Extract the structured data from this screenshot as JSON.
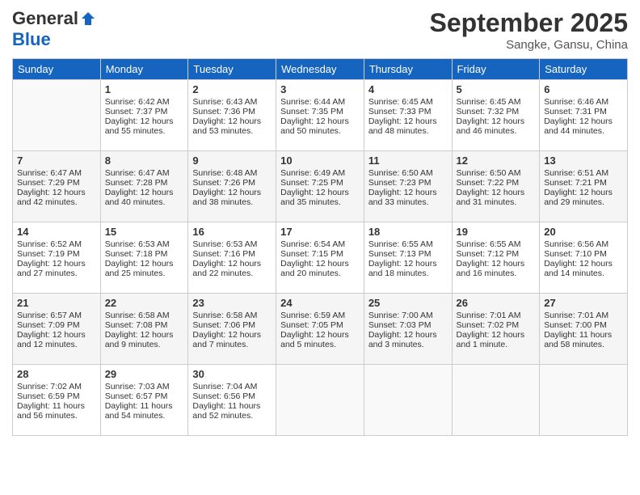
{
  "header": {
    "logo_general": "General",
    "logo_blue": "Blue",
    "month_title": "September 2025",
    "location": "Sangke, Gansu, China"
  },
  "days_of_week": [
    "Sunday",
    "Monday",
    "Tuesday",
    "Wednesday",
    "Thursday",
    "Friday",
    "Saturday"
  ],
  "weeks": [
    [
      {
        "day": "",
        "sunrise": "",
        "sunset": "",
        "daylight": "",
        "empty": true
      },
      {
        "day": "1",
        "sunrise": "Sunrise: 6:42 AM",
        "sunset": "Sunset: 7:37 PM",
        "daylight": "Daylight: 12 hours and 55 minutes."
      },
      {
        "day": "2",
        "sunrise": "Sunrise: 6:43 AM",
        "sunset": "Sunset: 7:36 PM",
        "daylight": "Daylight: 12 hours and 53 minutes."
      },
      {
        "day": "3",
        "sunrise": "Sunrise: 6:44 AM",
        "sunset": "Sunset: 7:35 PM",
        "daylight": "Daylight: 12 hours and 50 minutes."
      },
      {
        "day": "4",
        "sunrise": "Sunrise: 6:45 AM",
        "sunset": "Sunset: 7:33 PM",
        "daylight": "Daylight: 12 hours and 48 minutes."
      },
      {
        "day": "5",
        "sunrise": "Sunrise: 6:45 AM",
        "sunset": "Sunset: 7:32 PM",
        "daylight": "Daylight: 12 hours and 46 minutes."
      },
      {
        "day": "6",
        "sunrise": "Sunrise: 6:46 AM",
        "sunset": "Sunset: 7:31 PM",
        "daylight": "Daylight: 12 hours and 44 minutes."
      }
    ],
    [
      {
        "day": "7",
        "sunrise": "Sunrise: 6:47 AM",
        "sunset": "Sunset: 7:29 PM",
        "daylight": "Daylight: 12 hours and 42 minutes."
      },
      {
        "day": "8",
        "sunrise": "Sunrise: 6:47 AM",
        "sunset": "Sunset: 7:28 PM",
        "daylight": "Daylight: 12 hours and 40 minutes."
      },
      {
        "day": "9",
        "sunrise": "Sunrise: 6:48 AM",
        "sunset": "Sunset: 7:26 PM",
        "daylight": "Daylight: 12 hours and 38 minutes."
      },
      {
        "day": "10",
        "sunrise": "Sunrise: 6:49 AM",
        "sunset": "Sunset: 7:25 PM",
        "daylight": "Daylight: 12 hours and 35 minutes."
      },
      {
        "day": "11",
        "sunrise": "Sunrise: 6:50 AM",
        "sunset": "Sunset: 7:23 PM",
        "daylight": "Daylight: 12 hours and 33 minutes."
      },
      {
        "day": "12",
        "sunrise": "Sunrise: 6:50 AM",
        "sunset": "Sunset: 7:22 PM",
        "daylight": "Daylight: 12 hours and 31 minutes."
      },
      {
        "day": "13",
        "sunrise": "Sunrise: 6:51 AM",
        "sunset": "Sunset: 7:21 PM",
        "daylight": "Daylight: 12 hours and 29 minutes."
      }
    ],
    [
      {
        "day": "14",
        "sunrise": "Sunrise: 6:52 AM",
        "sunset": "Sunset: 7:19 PM",
        "daylight": "Daylight: 12 hours and 27 minutes."
      },
      {
        "day": "15",
        "sunrise": "Sunrise: 6:53 AM",
        "sunset": "Sunset: 7:18 PM",
        "daylight": "Daylight: 12 hours and 25 minutes."
      },
      {
        "day": "16",
        "sunrise": "Sunrise: 6:53 AM",
        "sunset": "Sunset: 7:16 PM",
        "daylight": "Daylight: 12 hours and 22 minutes."
      },
      {
        "day": "17",
        "sunrise": "Sunrise: 6:54 AM",
        "sunset": "Sunset: 7:15 PM",
        "daylight": "Daylight: 12 hours and 20 minutes."
      },
      {
        "day": "18",
        "sunrise": "Sunrise: 6:55 AM",
        "sunset": "Sunset: 7:13 PM",
        "daylight": "Daylight: 12 hours and 18 minutes."
      },
      {
        "day": "19",
        "sunrise": "Sunrise: 6:55 AM",
        "sunset": "Sunset: 7:12 PM",
        "daylight": "Daylight: 12 hours and 16 minutes."
      },
      {
        "day": "20",
        "sunrise": "Sunrise: 6:56 AM",
        "sunset": "Sunset: 7:10 PM",
        "daylight": "Daylight: 12 hours and 14 minutes."
      }
    ],
    [
      {
        "day": "21",
        "sunrise": "Sunrise: 6:57 AM",
        "sunset": "Sunset: 7:09 PM",
        "daylight": "Daylight: 12 hours and 12 minutes."
      },
      {
        "day": "22",
        "sunrise": "Sunrise: 6:58 AM",
        "sunset": "Sunset: 7:08 PM",
        "daylight": "Daylight: 12 hours and 9 minutes."
      },
      {
        "day": "23",
        "sunrise": "Sunrise: 6:58 AM",
        "sunset": "Sunset: 7:06 PM",
        "daylight": "Daylight: 12 hours and 7 minutes."
      },
      {
        "day": "24",
        "sunrise": "Sunrise: 6:59 AM",
        "sunset": "Sunset: 7:05 PM",
        "daylight": "Daylight: 12 hours and 5 minutes."
      },
      {
        "day": "25",
        "sunrise": "Sunrise: 7:00 AM",
        "sunset": "Sunset: 7:03 PM",
        "daylight": "Daylight: 12 hours and 3 minutes."
      },
      {
        "day": "26",
        "sunrise": "Sunrise: 7:01 AM",
        "sunset": "Sunset: 7:02 PM",
        "daylight": "Daylight: 12 hours and 1 minute."
      },
      {
        "day": "27",
        "sunrise": "Sunrise: 7:01 AM",
        "sunset": "Sunset: 7:00 PM",
        "daylight": "Daylight: 11 hours and 58 minutes."
      }
    ],
    [
      {
        "day": "28",
        "sunrise": "Sunrise: 7:02 AM",
        "sunset": "Sunset: 6:59 PM",
        "daylight": "Daylight: 11 hours and 56 minutes."
      },
      {
        "day": "29",
        "sunrise": "Sunrise: 7:03 AM",
        "sunset": "Sunset: 6:57 PM",
        "daylight": "Daylight: 11 hours and 54 minutes."
      },
      {
        "day": "30",
        "sunrise": "Sunrise: 7:04 AM",
        "sunset": "Sunset: 6:56 PM",
        "daylight": "Daylight: 11 hours and 52 minutes."
      },
      {
        "day": "",
        "sunrise": "",
        "sunset": "",
        "daylight": "",
        "empty": true
      },
      {
        "day": "",
        "sunrise": "",
        "sunset": "",
        "daylight": "",
        "empty": true
      },
      {
        "day": "",
        "sunrise": "",
        "sunset": "",
        "daylight": "",
        "empty": true
      },
      {
        "day": "",
        "sunrise": "",
        "sunset": "",
        "daylight": "",
        "empty": true
      }
    ]
  ]
}
